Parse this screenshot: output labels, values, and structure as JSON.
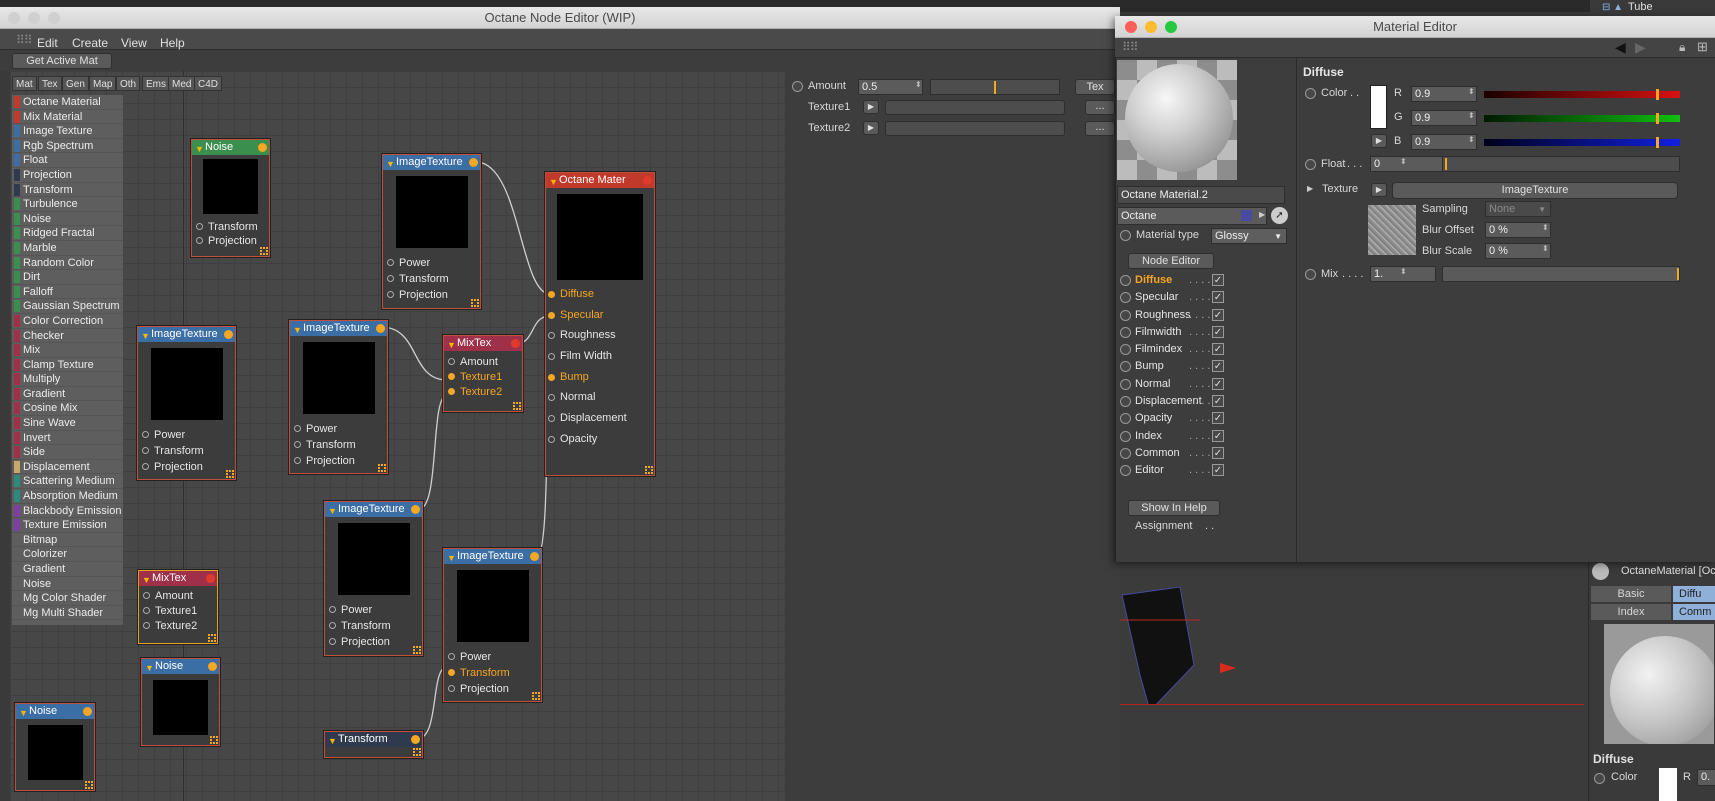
{
  "node_editor": {
    "title": "Octane Node Editor (WIP)",
    "menu": [
      "Edit",
      "Create",
      "View",
      "Help"
    ],
    "get_active_mat": "Get Active Mat",
    "tabs": [
      "Mat",
      "Tex",
      "Gen",
      "Map",
      "Oth",
      "Ems",
      "Med",
      "C4D"
    ],
    "node_list": [
      {
        "label": "Octane Material",
        "color": "#c0392b"
      },
      {
        "label": "Mix Material",
        "color": "#c0392b"
      },
      {
        "label": "Image Texture",
        "color": "#3b6ea5"
      },
      {
        "label": "Rgb Spectrum",
        "color": "#3b6ea5"
      },
      {
        "label": "Float",
        "color": "#3b6ea5"
      },
      {
        "label": "Projection",
        "color": "#2f3a4f"
      },
      {
        "label": "Transform",
        "color": "#2f3a4f"
      },
      {
        "label": "Turbulence",
        "color": "#3a8f4e"
      },
      {
        "label": "Noise",
        "color": "#3a8f4e"
      },
      {
        "label": "Ridged Fractal",
        "color": "#3a8f4e"
      },
      {
        "label": "Marble",
        "color": "#3a8f4e"
      },
      {
        "label": "Random Color",
        "color": "#3a8f4e"
      },
      {
        "label": "Dirt",
        "color": "#3a8f4e"
      },
      {
        "label": "Falloff",
        "color": "#3a8f4e"
      },
      {
        "label": "Gaussian Spectrum",
        "color": "#3a8f4e"
      },
      {
        "label": "Color Correction",
        "color": "#a0304a"
      },
      {
        "label": "Checker",
        "color": "#a0304a"
      },
      {
        "label": "Mix",
        "color": "#a0304a"
      },
      {
        "label": "Clamp Texture",
        "color": "#a0304a"
      },
      {
        "label": "Multiply",
        "color": "#a0304a"
      },
      {
        "label": "Gradient",
        "color": "#a0304a"
      },
      {
        "label": "Cosine Mix",
        "color": "#a0304a"
      },
      {
        "label": "Sine Wave",
        "color": "#a0304a"
      },
      {
        "label": "Invert",
        "color": "#a0304a"
      },
      {
        "label": "Side",
        "color": "#a0304a"
      },
      {
        "label": "Displacement",
        "color": "#c9a86a"
      },
      {
        "label": "Scattering Medium",
        "color": "#2e8a7a"
      },
      {
        "label": "Absorption Medium",
        "color": "#2e8a7a"
      },
      {
        "label": "Blackbody Emission",
        "color": "#7d3fa0"
      },
      {
        "label": "Texture Emission",
        "color": "#7d3fa0"
      },
      {
        "label": "Bitmap",
        "color": "#5e5e5e"
      },
      {
        "label": "Colorizer",
        "color": "#5e5e5e"
      },
      {
        "label": "Gradient",
        "color": "#5e5e5e"
      },
      {
        "label": "Noise",
        "color": "#5e5e5e"
      },
      {
        "label": "Mg Color Shader",
        "color": "#5e5e5e"
      },
      {
        "label": "Mg Multi Shader",
        "color": "#5e5e5e"
      }
    ],
    "nodes": {
      "noise1": {
        "title": "Noise",
        "ports": [
          "Transform",
          "Projection"
        ]
      },
      "imgtex1": {
        "title": "ImageTexture",
        "ports": [
          "Power",
          "Transform",
          "Projection"
        ]
      },
      "imgtex2": {
        "title": "ImageTexture",
        "ports": [
          "Power",
          "Transform",
          "Projection"
        ]
      },
      "imgtex3": {
        "title": "ImageTexture",
        "ports": [
          "Power",
          "Transform",
          "Projection"
        ]
      },
      "mixtex1": {
        "title": "MixTex",
        "ports": [
          "Amount",
          "Texture1",
          "Texture2"
        ]
      },
      "octmat": {
        "title": "Octane Mater",
        "ports": [
          "Diffuse",
          "Specular",
          "Roughness",
          "Film Width",
          "Bump",
          "Normal",
          "Displacement",
          "Opacity"
        ]
      },
      "imgtex4": {
        "title": "ImageTexture",
        "ports": [
          "Power",
          "Transform",
          "Projection"
        ]
      },
      "imgtex5": {
        "title": "ImageTexture",
        "ports": [
          "Power",
          "Transform",
          "Projection"
        ]
      },
      "mixtex2": {
        "title": "MixTex",
        "ports": [
          "Amount",
          "Texture1",
          "Texture2"
        ]
      },
      "noise2": {
        "title": "Noise"
      },
      "noise3": {
        "title": "Noise"
      },
      "transform": {
        "title": "Transform"
      }
    },
    "inspector": {
      "amount_label": "Amount",
      "amount_value": "0.5",
      "amount_fraction": 0.5,
      "tex_button": "Tex",
      "texture1": "Texture1",
      "texture2": "Texture2",
      "dots": "..."
    }
  },
  "material_editor": {
    "title": "Material Editor",
    "material_name": "Octane Material.2",
    "renderer": "Octane",
    "material_type_label": "Material type",
    "material_type_value": "Glossy",
    "node_editor_button": "Node Editor",
    "channels": [
      {
        "label": "Diffuse",
        "active": true
      },
      {
        "label": "Specular"
      },
      {
        "label": "Roughness"
      },
      {
        "label": "Filmwidth"
      },
      {
        "label": "Filmindex"
      },
      {
        "label": "Bump"
      },
      {
        "label": "Normal"
      },
      {
        "label": "Displacement"
      },
      {
        "label": "Opacity"
      },
      {
        "label": "Index"
      },
      {
        "label": "Common"
      },
      {
        "label": "Editor"
      }
    ],
    "check": "✓",
    "show_in_help": "Show In Help",
    "assignment": "Assignment",
    "diffuse": {
      "heading": "Diffuse",
      "color_label": "Color",
      "r_label": "R",
      "r_value": "0.9",
      "g_label": "G",
      "g_value": "0.9",
      "b_label": "B",
      "b_value": "0.9",
      "float_label": "Float",
      "float_value": "0",
      "texture_label": "Texture",
      "texture_value": "ImageTexture",
      "sampling_label": "Sampling",
      "sampling_value": "None",
      "blur_offset_label": "Blur Offset",
      "blur_offset_value": "0 %",
      "blur_scale_label": "Blur Scale",
      "blur_scale_value": "0 %",
      "mix_label": "Mix",
      "mix_value": "1."
    }
  },
  "background": {
    "object_tree_item": "Tube",
    "attr_title": "OctaneMaterial [Oc",
    "attr_tabs": [
      "Basic",
      "Diffu",
      "Index",
      "Comm"
    ],
    "diffuse_heading": "Diffuse",
    "color_label": "Color",
    "r_label": "R",
    "r_value": "0."
  }
}
